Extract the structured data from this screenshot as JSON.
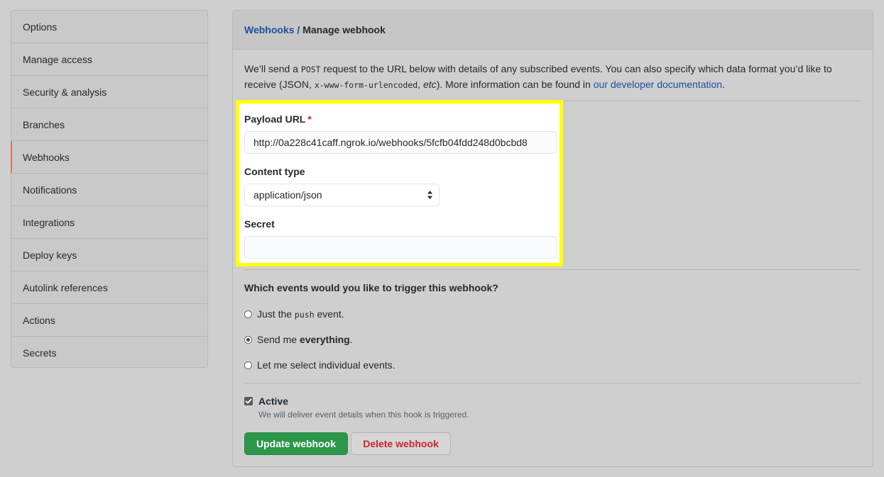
{
  "sidebar": {
    "items": [
      {
        "label": "Options"
      },
      {
        "label": "Manage access"
      },
      {
        "label": "Security & analysis"
      },
      {
        "label": "Branches"
      },
      {
        "label": "Webhooks",
        "active": true
      },
      {
        "label": "Notifications"
      },
      {
        "label": "Integrations"
      },
      {
        "label": "Deploy keys"
      },
      {
        "label": "Autolink references"
      },
      {
        "label": "Actions"
      },
      {
        "label": "Secrets"
      }
    ]
  },
  "header": {
    "breadcrumb_link": "Webhooks",
    "separator": "/",
    "current": "Manage webhook"
  },
  "intro": {
    "part1": "We’ll send a ",
    "code1": "POST",
    "part2": " request to the URL below with details of any subscribed events. You can also specify which data format you’d like to receive (JSON, ",
    "code2": "x-www-form-urlencoded",
    "part3": ", ",
    "etc": "etc",
    "part4": "). More information can be found in ",
    "link": "our developer documentation",
    "part5": "."
  },
  "form": {
    "payload_label": "Payload URL",
    "required_mark": "*",
    "payload_value": "http://0a228c41caff.ngrok.io/webhooks/5fcfb04fdd248d0bcbd8",
    "content_type_label": "Content type",
    "content_type_value": "application/json",
    "secret_label": "Secret",
    "secret_value": ""
  },
  "events": {
    "title": "Which events would you like to trigger this webhook?",
    "option1_pre": "Just the ",
    "option1_code": "push",
    "option1_post": " event.",
    "option2_pre": "Send me ",
    "option2_bold": "everything",
    "option2_post": ".",
    "option3": "Let me select individual events.",
    "selected": 2
  },
  "active": {
    "label": "Active",
    "checked": true,
    "note": "We will deliver event details when this hook is triggered."
  },
  "buttons": {
    "update": "Update webhook",
    "delete": "Delete webhook"
  },
  "colors": {
    "highlight": "#ffff00",
    "link": "#1b4f9e",
    "primary": "#2c974b",
    "danger": "#cb2431",
    "active_marker": "#d9794e"
  }
}
